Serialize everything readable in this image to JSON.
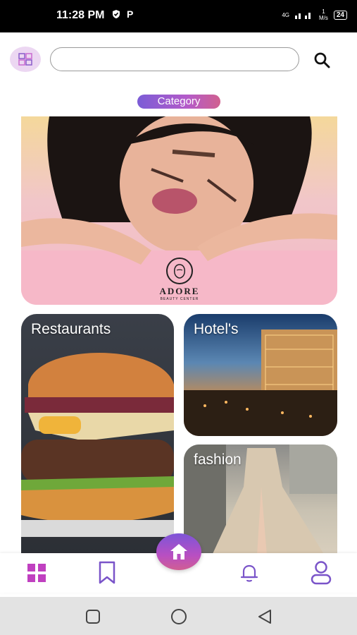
{
  "status": {
    "time": "11:28 PM",
    "network": "4G",
    "speed_value": "1",
    "speed_unit": "M/s",
    "battery": "24"
  },
  "search": {
    "placeholder": ""
  },
  "category_label": "Category",
  "banner": {
    "brand_name": "ADORE",
    "brand_sub": "BEAUTY CENTER"
  },
  "cards": {
    "restaurants": "Restaurants",
    "hotels": "Hotel's",
    "fashion": "fashion"
  },
  "colors": {
    "accent_start": "#7b5cd6",
    "accent_end": "#d0608f",
    "nav_active": "#c040c0",
    "nav_inactive": "#7a54c9"
  },
  "nav": {
    "icons": [
      "grid-icon",
      "bookmark-icon",
      "home-icon",
      "bell-icon",
      "profile-icon"
    ]
  }
}
